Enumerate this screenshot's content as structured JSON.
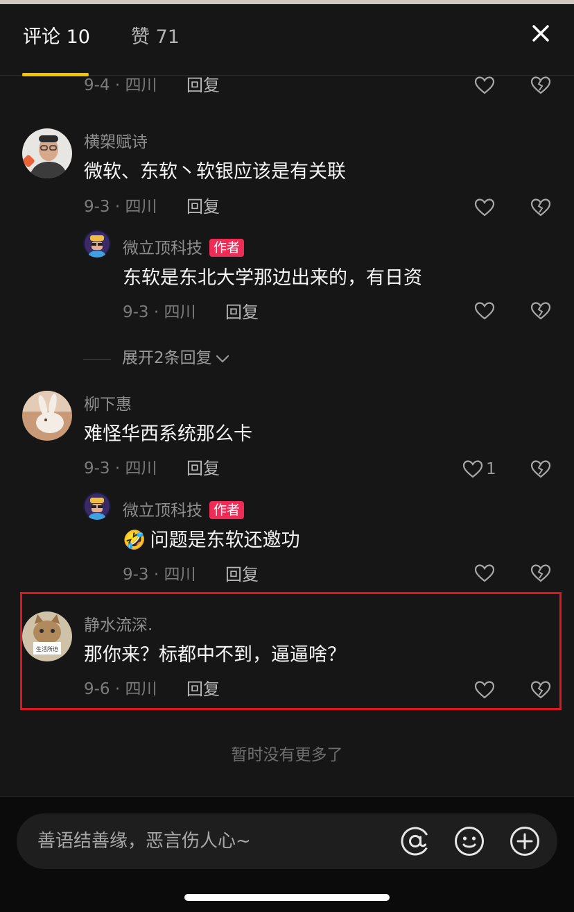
{
  "tabs": {
    "comments": "评论 10",
    "likes": "赞 71"
  },
  "comments": [
    {
      "meta": "9-4 · 四川",
      "reply": "回复"
    },
    {
      "user": "横槊赋诗",
      "text": "微软、东软丶软银应该是有关联",
      "meta": "9-3 · 四川",
      "reply": "回复"
    },
    {
      "user": "微立顶科技",
      "badge": "作者",
      "text": "东软是东北大学那边出来的，有日资",
      "meta": "9-3 · 四川",
      "reply": "回复"
    },
    {
      "user": "柳下惠",
      "text": "难怪华西系统那么卡",
      "meta": "9-3 · 四川",
      "reply": "回复",
      "likes": "1"
    },
    {
      "user": "微立顶科技",
      "badge": "作者",
      "emoji": "🤣",
      "text": "问题是东软还邀功",
      "meta": "9-3 · 四川",
      "reply": "回复"
    },
    {
      "user": "静水流深.",
      "text": "那你来？标都中不到，逼逼啥？",
      "meta": "9-6 · 四川",
      "reply": "回复"
    }
  ],
  "expand_replies": "展开2条回复",
  "no_more": "暂时没有更多了",
  "input": {
    "placeholder": "善语结善缘，恶言伤人心~"
  },
  "avatar_sign_text": "生活所迫",
  "icons": [
    "close-icon",
    "heart-icon",
    "broken-heart-icon",
    "chevron-down-icon",
    "at-icon",
    "emoji-icon",
    "plus-icon"
  ],
  "colors": {
    "accent": "#f5c400",
    "author_badge": "#ee2c55",
    "highlight_box": "#e0151d"
  }
}
